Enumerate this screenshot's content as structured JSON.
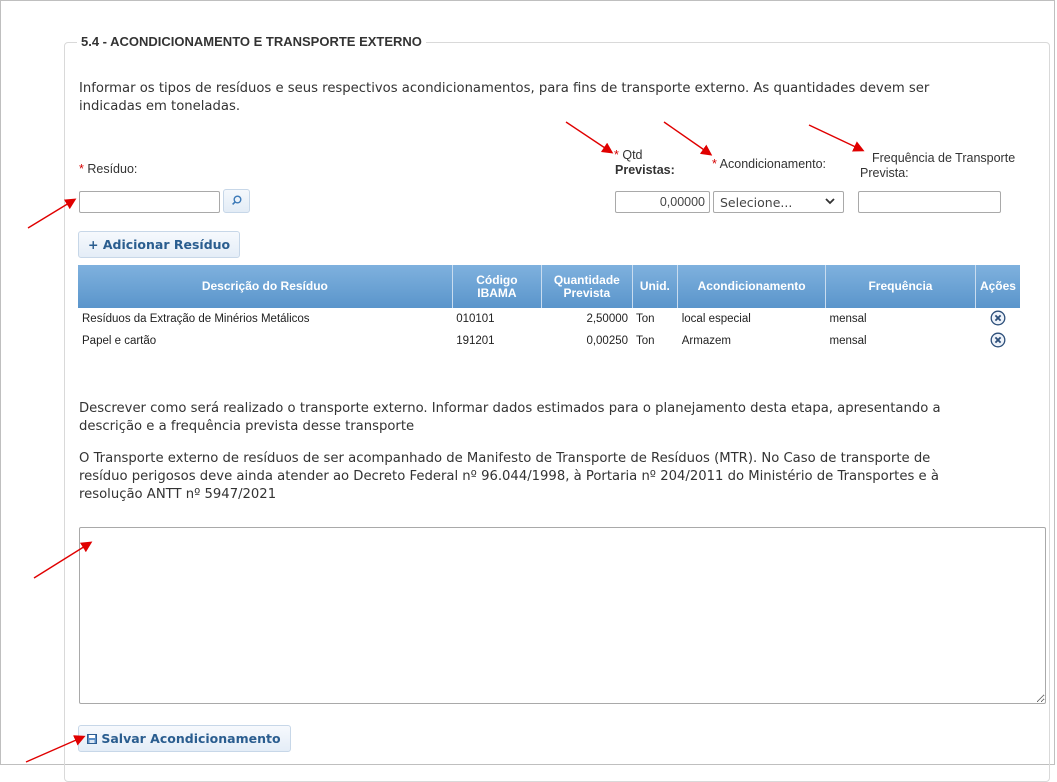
{
  "section": {
    "title": "5.4 - ACONDICIONAMENTO E TRANSPORTE EXTERNO",
    "intro_line1": "Informar os tipos de resíduos e seus respectivos acondicionamentos, para fins de transporte externo. As quantidades devem ser",
    "intro_line2": "indicadas em toneladas."
  },
  "form": {
    "required_mark": "*",
    "residuo_label": "Resíduo:",
    "qtd_label_line1": "Qtd",
    "qtd_label_line2": "Previstas:",
    "qtd_value": "0,00000",
    "acond_label": "Acondicionamento:",
    "acond_selected": "Selecione...",
    "freq_label_line1": "Frequência de Transporte",
    "freq_label_line2": "Prevista:",
    "add_button": "+ Adicionar Resíduo"
  },
  "table": {
    "headers": {
      "descricao": "Descrição do Resíduo",
      "codigo_l1": "Código",
      "codigo_l2": "IBAMA",
      "qtd_l1": "Quantidade",
      "qtd_l2": "Prevista",
      "unid": "Unid.",
      "acond": "Acondicionamento",
      "freq": "Frequência",
      "acoes": "Ações"
    },
    "rows": [
      {
        "descricao": "Resíduos da Extração de Minérios Metálicos",
        "codigo": "010101",
        "quantidade": "2,50000",
        "unid": "Ton",
        "acond": "local especial",
        "freq": "mensal"
      },
      {
        "descricao": "Papel e cartão",
        "codigo": "191201",
        "quantidade": "0,00250",
        "unid": "Ton",
        "acond": "Armazem",
        "freq": "mensal"
      }
    ]
  },
  "transport": {
    "desc_line1": "Descrever como será realizado o transporte externo. Informar dados estimados para o planejamento desta etapa, apresentando a",
    "desc_line2": "descrição e a frequência prevista desse transporte",
    "mtr_line1": "O Transporte externo de resíduos de ser acompanhado de Manifesto de Transporte de Resíduos (MTR). No Caso de transporte de",
    "mtr_line2": "resíduo perigosos deve ainda atender ao Decreto Federal nº 96.044/1998, à Portaria nº 204/2011 do Ministério de Transportes e à",
    "mtr_line3": "resolução ANTT nº 5947/2021",
    "save_button": "Salvar Acondicionamento"
  },
  "colors": {
    "table_header": "#6aa3d6",
    "button_text": "#2a5d8f",
    "required": "#d40000",
    "arrow": "#e00000"
  }
}
